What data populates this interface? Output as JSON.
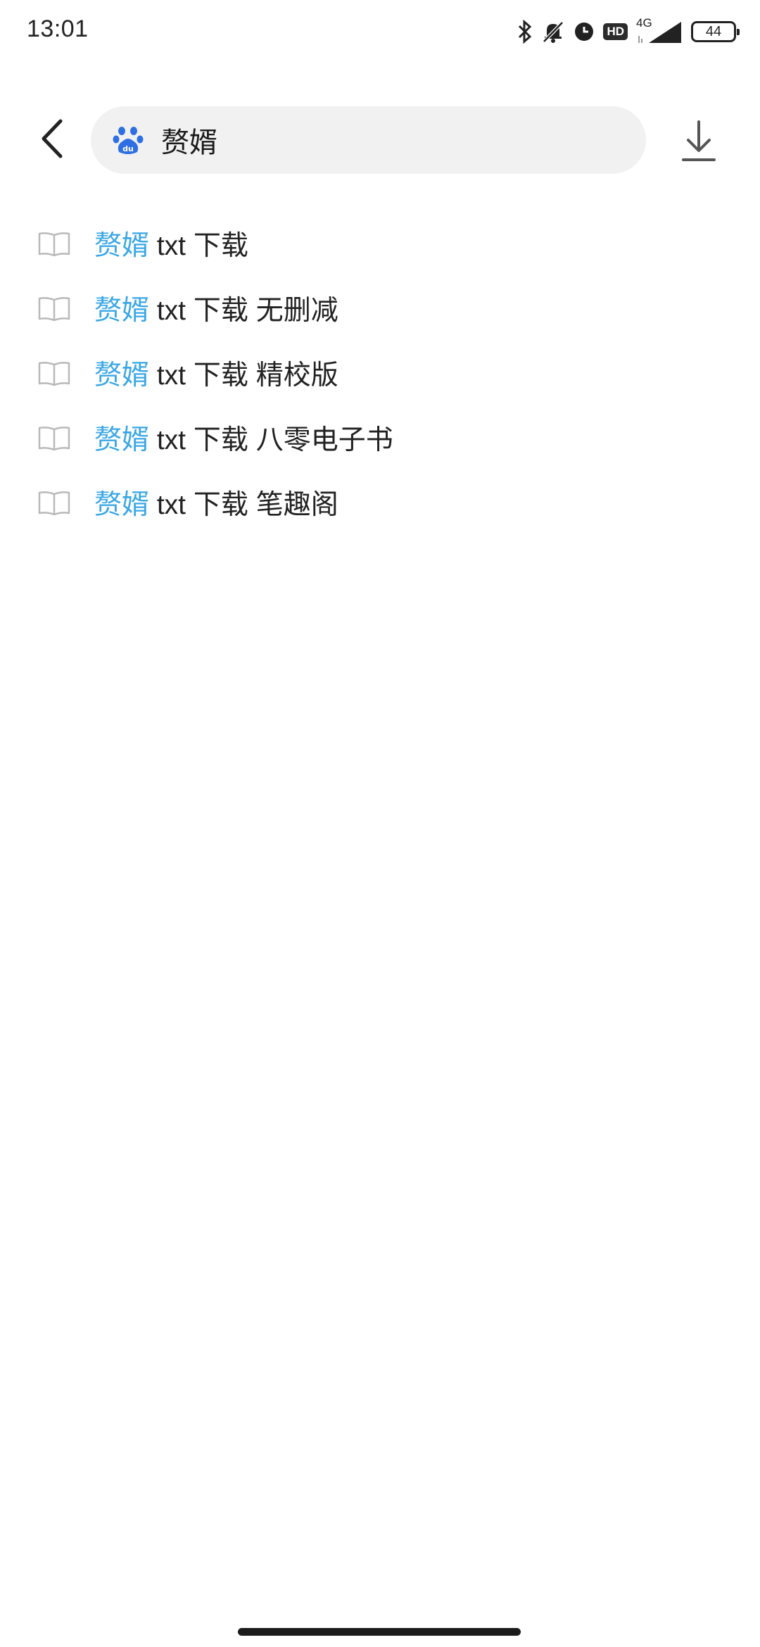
{
  "status_bar": {
    "time": "13:01",
    "hd": "HD",
    "network": "4G",
    "battery": "44"
  },
  "search": {
    "query": "赘婿",
    "engine_icon": "baidu-paw-icon"
  },
  "suggestions": [
    {
      "highlight": "赘婿",
      "rest": " txt 下载"
    },
    {
      "highlight": "赘婿",
      "rest": " txt 下载 无删减"
    },
    {
      "highlight": "赘婿",
      "rest": " txt 下载 精校版"
    },
    {
      "highlight": "赘婿",
      "rest": " txt 下载 八零电子书"
    },
    {
      "highlight": "赘婿",
      "rest": " txt 下载 笔趣阁"
    }
  ],
  "colors": {
    "highlight": "#3aa7e6",
    "search_bg": "#f1f1f1",
    "baidu_blue": "#2f6fe4"
  }
}
